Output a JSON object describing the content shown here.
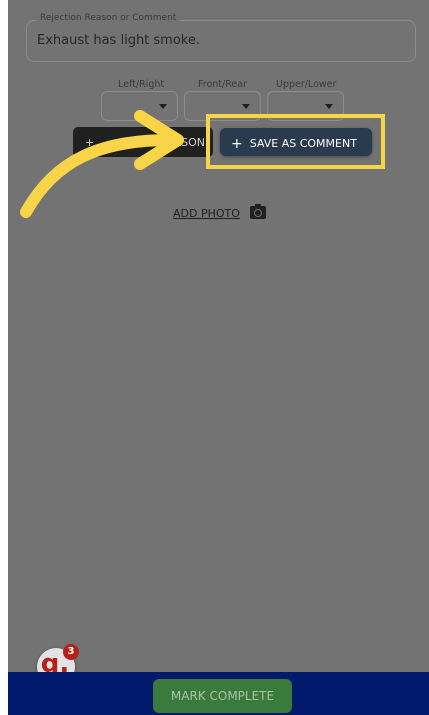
{
  "comment_field": {
    "label": "Rejection Reason or Comment",
    "value": "Exhaust has light smoke."
  },
  "location_selects": [
    {
      "label": "Left/Right",
      "value": ""
    },
    {
      "label": "Front/Rear",
      "value": ""
    },
    {
      "label": "Upper/Lower",
      "value": ""
    }
  ],
  "buttons": {
    "reject_reason_partial": "ASON",
    "reject_plus": "+",
    "save_plus": "+",
    "save_comment": "SAVE AS COMMENT",
    "add_photo": "ADD PHOTO",
    "mark_complete": "MARK COMPLETE"
  },
  "avatar": {
    "letter": "g.",
    "badge_count": "3"
  },
  "icons": [
    "camera-icon",
    "caret-down-icon",
    "plus-icon",
    "tutorial-arrow"
  ],
  "colors": {
    "highlight": "#f7d448",
    "save_button": "#2a3a4f",
    "bottom_bar": "#011a6b",
    "complete_button": "#3a7a3a",
    "brand_red": "#b52018"
  }
}
